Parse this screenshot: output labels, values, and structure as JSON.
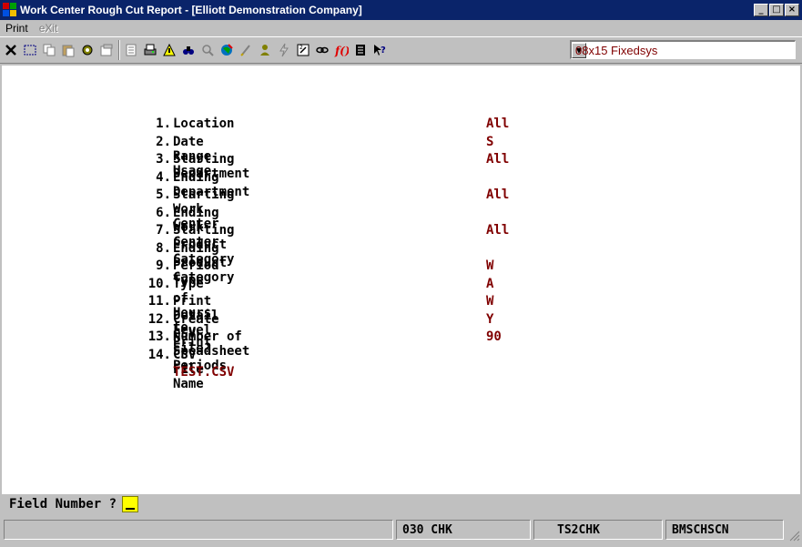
{
  "window": {
    "title": "Work Center Rough Cut Report - [Elliott Demonstration Company]",
    "minimize_label": "_",
    "maximize_label": "□",
    "close_label": "×"
  },
  "menu": {
    "items": [
      {
        "label": "Print",
        "enabled": true
      },
      {
        "label": "eXit",
        "enabled": false
      }
    ]
  },
  "toolbar": {
    "icons": [
      "close-icon",
      "select-icon",
      "copy-icon",
      "paste-icon",
      "settings-icon",
      "properties-icon",
      "notes-icon",
      "print-icon",
      "alert-icon",
      "binoculars-icon",
      "zoom-icon",
      "globe-icon",
      "edit-icon",
      "user-icon",
      "lightning-icon",
      "calc-icon",
      "link-icon",
      "function-icon",
      "report-icon",
      "help-pointer-icon"
    ],
    "font_select": "08x15 Fixedsys"
  },
  "form": {
    "fields": [
      {
        "num": "1.",
        "label": "Location",
        "value": "All"
      },
      {
        "num": "2.",
        "label": "Date Range Usage",
        "value": "S"
      },
      {
        "num": "3.",
        "label": "Starting Department",
        "value": "All"
      },
      {
        "num": "4.",
        "label": "Ending Department",
        "value": ""
      },
      {
        "num": "5.",
        "label": "Starting Work Center",
        "value": "All"
      },
      {
        "num": "6.",
        "label": "Ending Work Center",
        "value": ""
      },
      {
        "num": "7.",
        "label": "Starting Product Category",
        "value": "All"
      },
      {
        "num": "8.",
        "label": "Ending Product Category",
        "value": ""
      },
      {
        "num": "9.",
        "label": "Period Type",
        "value": "W"
      },
      {
        "num": "10.",
        "label": "Type of Hours to Print",
        "value": "A"
      },
      {
        "num": "11.",
        "label": "Print Detail Level",
        "value": "W"
      },
      {
        "num": "12.",
        "label": "Create CSV File?",
        "value": "Y"
      },
      {
        "num": "13.",
        "label": "Number of Speadsheet Periods",
        "value": "90"
      },
      {
        "num": "14.",
        "label": "CSV File Name",
        "value": ""
      }
    ],
    "csv_file_name": "TEST.CSV"
  },
  "prompt": {
    "text": "Field Number ?"
  },
  "status": {
    "cells": [
      "",
      "030 CHK",
      "TS2CHK",
      "BMSCHSCN"
    ]
  },
  "colors": {
    "title_bar": "#0a246a",
    "value_text": "#800000",
    "input_highlight": "#ffff00"
  }
}
